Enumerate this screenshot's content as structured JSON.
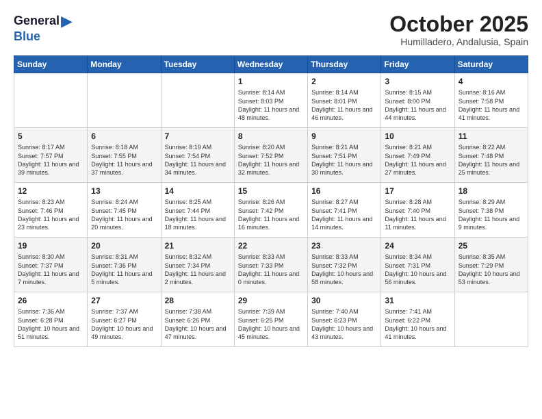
{
  "logo": {
    "general": "General",
    "blue": "Blue",
    "arrow": "▶"
  },
  "title": "October 2025",
  "subtitle": "Humilladero, Andalusia, Spain",
  "days_of_week": [
    "Sunday",
    "Monday",
    "Tuesday",
    "Wednesday",
    "Thursday",
    "Friday",
    "Saturday"
  ],
  "weeks": [
    [
      {
        "day": "",
        "info": ""
      },
      {
        "day": "",
        "info": ""
      },
      {
        "day": "",
        "info": ""
      },
      {
        "day": "1",
        "info": "Sunrise: 8:14 AM\nSunset: 8:03 PM\nDaylight: 11 hours\nand 48 minutes."
      },
      {
        "day": "2",
        "info": "Sunrise: 8:14 AM\nSunset: 8:01 PM\nDaylight: 11 hours\nand 46 minutes."
      },
      {
        "day": "3",
        "info": "Sunrise: 8:15 AM\nSunset: 8:00 PM\nDaylight: 11 hours\nand 44 minutes."
      },
      {
        "day": "4",
        "info": "Sunrise: 8:16 AM\nSunset: 7:58 PM\nDaylight: 11 hours\nand 41 minutes."
      }
    ],
    [
      {
        "day": "5",
        "info": "Sunrise: 8:17 AM\nSunset: 7:57 PM\nDaylight: 11 hours\nand 39 minutes."
      },
      {
        "day": "6",
        "info": "Sunrise: 8:18 AM\nSunset: 7:55 PM\nDaylight: 11 hours\nand 37 minutes."
      },
      {
        "day": "7",
        "info": "Sunrise: 8:19 AM\nSunset: 7:54 PM\nDaylight: 11 hours\nand 34 minutes."
      },
      {
        "day": "8",
        "info": "Sunrise: 8:20 AM\nSunset: 7:52 PM\nDaylight: 11 hours\nand 32 minutes."
      },
      {
        "day": "9",
        "info": "Sunrise: 8:21 AM\nSunset: 7:51 PM\nDaylight: 11 hours\nand 30 minutes."
      },
      {
        "day": "10",
        "info": "Sunrise: 8:21 AM\nSunset: 7:49 PM\nDaylight: 11 hours\nand 27 minutes."
      },
      {
        "day": "11",
        "info": "Sunrise: 8:22 AM\nSunset: 7:48 PM\nDaylight: 11 hours\nand 25 minutes."
      }
    ],
    [
      {
        "day": "12",
        "info": "Sunrise: 8:23 AM\nSunset: 7:46 PM\nDaylight: 11 hours\nand 23 minutes."
      },
      {
        "day": "13",
        "info": "Sunrise: 8:24 AM\nSunset: 7:45 PM\nDaylight: 11 hours\nand 20 minutes."
      },
      {
        "day": "14",
        "info": "Sunrise: 8:25 AM\nSunset: 7:44 PM\nDaylight: 11 hours\nand 18 minutes."
      },
      {
        "day": "15",
        "info": "Sunrise: 8:26 AM\nSunset: 7:42 PM\nDaylight: 11 hours\nand 16 minutes."
      },
      {
        "day": "16",
        "info": "Sunrise: 8:27 AM\nSunset: 7:41 PM\nDaylight: 11 hours\nand 14 minutes."
      },
      {
        "day": "17",
        "info": "Sunrise: 8:28 AM\nSunset: 7:40 PM\nDaylight: 11 hours\nand 11 minutes."
      },
      {
        "day": "18",
        "info": "Sunrise: 8:29 AM\nSunset: 7:38 PM\nDaylight: 11 hours\nand 9 minutes."
      }
    ],
    [
      {
        "day": "19",
        "info": "Sunrise: 8:30 AM\nSunset: 7:37 PM\nDaylight: 11 hours\nand 7 minutes."
      },
      {
        "day": "20",
        "info": "Sunrise: 8:31 AM\nSunset: 7:36 PM\nDaylight: 11 hours\nand 5 minutes."
      },
      {
        "day": "21",
        "info": "Sunrise: 8:32 AM\nSunset: 7:34 PM\nDaylight: 11 hours\nand 2 minutes."
      },
      {
        "day": "22",
        "info": "Sunrise: 8:33 AM\nSunset: 7:33 PM\nDaylight: 11 hours\nand 0 minutes."
      },
      {
        "day": "23",
        "info": "Sunrise: 8:33 AM\nSunset: 7:32 PM\nDaylight: 10 hours\nand 58 minutes."
      },
      {
        "day": "24",
        "info": "Sunrise: 8:34 AM\nSunset: 7:31 PM\nDaylight: 10 hours\nand 56 minutes."
      },
      {
        "day": "25",
        "info": "Sunrise: 8:35 AM\nSunset: 7:29 PM\nDaylight: 10 hours\nand 53 minutes."
      }
    ],
    [
      {
        "day": "26",
        "info": "Sunrise: 7:36 AM\nSunset: 6:28 PM\nDaylight: 10 hours\nand 51 minutes."
      },
      {
        "day": "27",
        "info": "Sunrise: 7:37 AM\nSunset: 6:27 PM\nDaylight: 10 hours\nand 49 minutes."
      },
      {
        "day": "28",
        "info": "Sunrise: 7:38 AM\nSunset: 6:26 PM\nDaylight: 10 hours\nand 47 minutes."
      },
      {
        "day": "29",
        "info": "Sunrise: 7:39 AM\nSunset: 6:25 PM\nDaylight: 10 hours\nand 45 minutes."
      },
      {
        "day": "30",
        "info": "Sunrise: 7:40 AM\nSunset: 6:23 PM\nDaylight: 10 hours\nand 43 minutes."
      },
      {
        "day": "31",
        "info": "Sunrise: 7:41 AM\nSunset: 6:22 PM\nDaylight: 10 hours\nand 41 minutes."
      },
      {
        "day": "",
        "info": ""
      }
    ]
  ]
}
